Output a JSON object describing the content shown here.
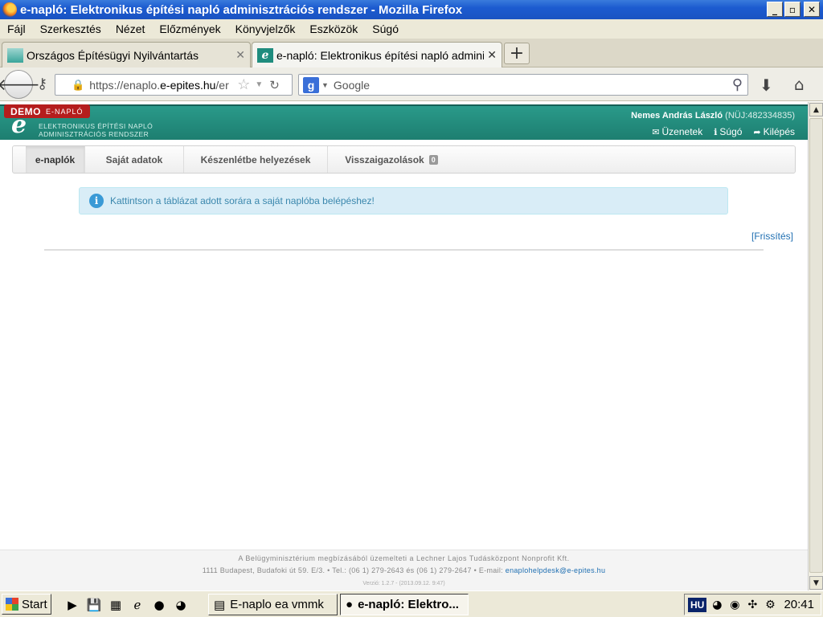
{
  "window": {
    "title": "e-napló: Elektronikus építési napló adminisztrációs rendszer - Mozilla Firefox",
    "min": "_",
    "max": "▫",
    "close": "✕"
  },
  "menu": [
    "Fájl",
    "Szerkesztés",
    "Nézet",
    "Előzmények",
    "Könyvjelzők",
    "Eszközök",
    "Súgó"
  ],
  "tabs": [
    {
      "label": "Országos Építésügyi Nyilvántartás",
      "close": "✕"
    },
    {
      "label": "e-napló: Elektronikus építési napló admini...",
      "close": "✕"
    }
  ],
  "newtab": "+",
  "nav": {
    "url_prefix": "https://enaplo.",
    "url_domain": "e-epites.hu",
    "url_suffix": "/er",
    "search_placeholder": "Google",
    "search_engine_letter": "g"
  },
  "app": {
    "demo": "DEMO",
    "demo_sub": "E-NAPLÓ",
    "logo_letter": "e",
    "logo_line1": "ELEKTRONIKUS ÉPÍTÉSI NAPLÓ",
    "logo_line2": "ADMINISZTRÁCIÓS RENDSZER",
    "user_name": "Nemes András László",
    "user_id": "(NÜJ:482334835)",
    "links": [
      {
        "icon": "✉",
        "label": "Üzenetek"
      },
      {
        "icon": "ℹ",
        "label": "Súgó"
      },
      {
        "icon": "➦",
        "label": "Kilépés"
      }
    ],
    "tabs": [
      {
        "label": "e-naplók"
      },
      {
        "label": "Saját adatok"
      },
      {
        "label": "Készenlétbe helyezések"
      },
      {
        "label": "Visszaigazolások",
        "badge": "0"
      }
    ],
    "info": "Kattintson a táblázat adott sorára a saját naplóba belépéshez!",
    "info_icon": "i",
    "refresh": "[Frissítés]"
  },
  "footer": {
    "line1": "A Belügyminisztérium megbízásából üzemelteti a Lechner Lajos Tudásközpont Nonprofit Kft.",
    "line2": "1111 Budapest, Budafoki út 59. E/3. • Tel.: (06 1) 279-2643 és (06 1) 279-2647 • E-mail:",
    "email": "enaplohelpdesk@e-epites.hu",
    "version": "Verzió: 1.2.7 - (2013.09.12. 9:47)"
  },
  "taskbar": {
    "start": "Start",
    "items": [
      {
        "label": "E-naplo ea vmmk"
      },
      {
        "label": "e-napló: Elektro..."
      }
    ],
    "lang": "HU",
    "clock": "20:41"
  }
}
